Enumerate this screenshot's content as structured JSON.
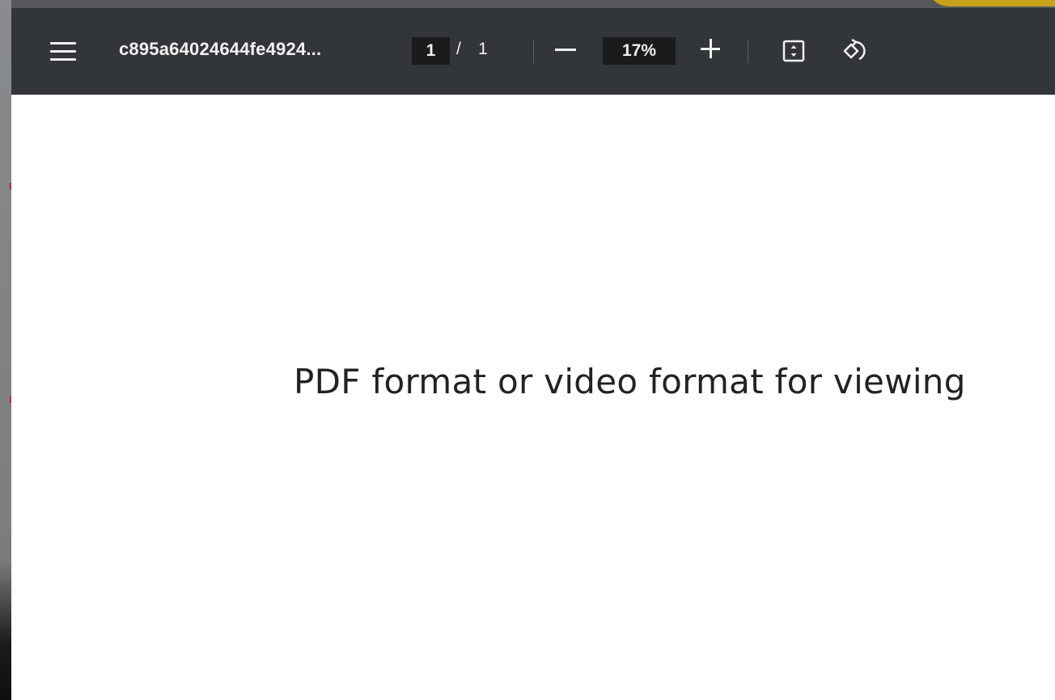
{
  "toolbar": {
    "menu_icon": "hamburger-menu-icon",
    "file_title": "c895a64024644fe4924...",
    "current_page": "1",
    "page_separator": "/",
    "total_pages": "1",
    "zoom_out_icon": "minus-icon",
    "zoom_level": "17%",
    "zoom_in_icon": "plus-icon",
    "fit_icon": "fit-to-page-icon",
    "rotate_icon": "rotate-icon"
  },
  "document": {
    "page_text": "PDF format or video format for viewing"
  },
  "colors": {
    "toolbar_bg": "#323639",
    "input_bg": "#191b1c",
    "page_bg": "#ffffff",
    "accent_corner": "#c9a21b"
  }
}
